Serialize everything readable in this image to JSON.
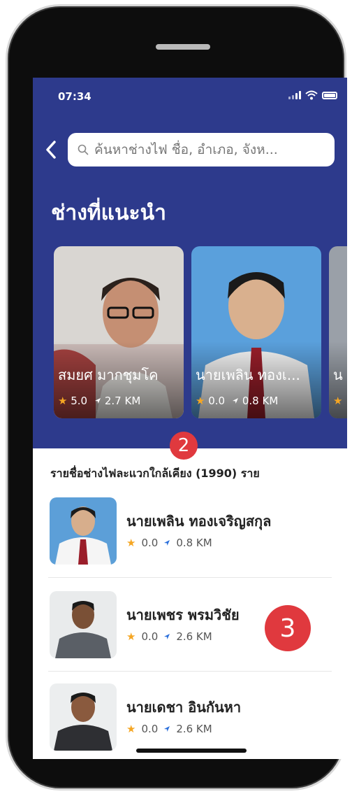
{
  "status_bar": {
    "time": "07:34"
  },
  "search": {
    "placeholder": "ค้นหาช่างไฟ ชื่อ, อำเภอ, จังห..."
  },
  "hero": {
    "title": "ช่างที่แนะนำ"
  },
  "recommended": [
    {
      "name": "สมยศ มากชุมโค",
      "rating": "5.0",
      "distance": "2.7 KM"
    },
    {
      "name": "นายเพลิน ทองเ...",
      "rating": "0.0",
      "distance": "0.8 KM"
    },
    {
      "name": "น",
      "rating": "",
      "distance": ""
    }
  ],
  "badges": {
    "two": "2",
    "three": "3"
  },
  "list": {
    "header": "รายชื่อช่างไฟละแวกใกล้เคียง (1990) ราย",
    "items": [
      {
        "name": "นายเพลิน ทองเจริญสกุล",
        "rating": "0.0",
        "distance": "0.8 KM"
      },
      {
        "name": "นายเพชร พรมวิชัย",
        "rating": "0.0",
        "distance": "2.6 KM"
      },
      {
        "name": "นายเดชา  อินกันหา",
        "rating": "0.0",
        "distance": "2.6 KM"
      }
    ]
  },
  "colors": {
    "hero_bg": "#2d3a8c",
    "star": "#f5a623",
    "distance_arrow": "#2a6fdb",
    "badge": "#e0393e"
  }
}
